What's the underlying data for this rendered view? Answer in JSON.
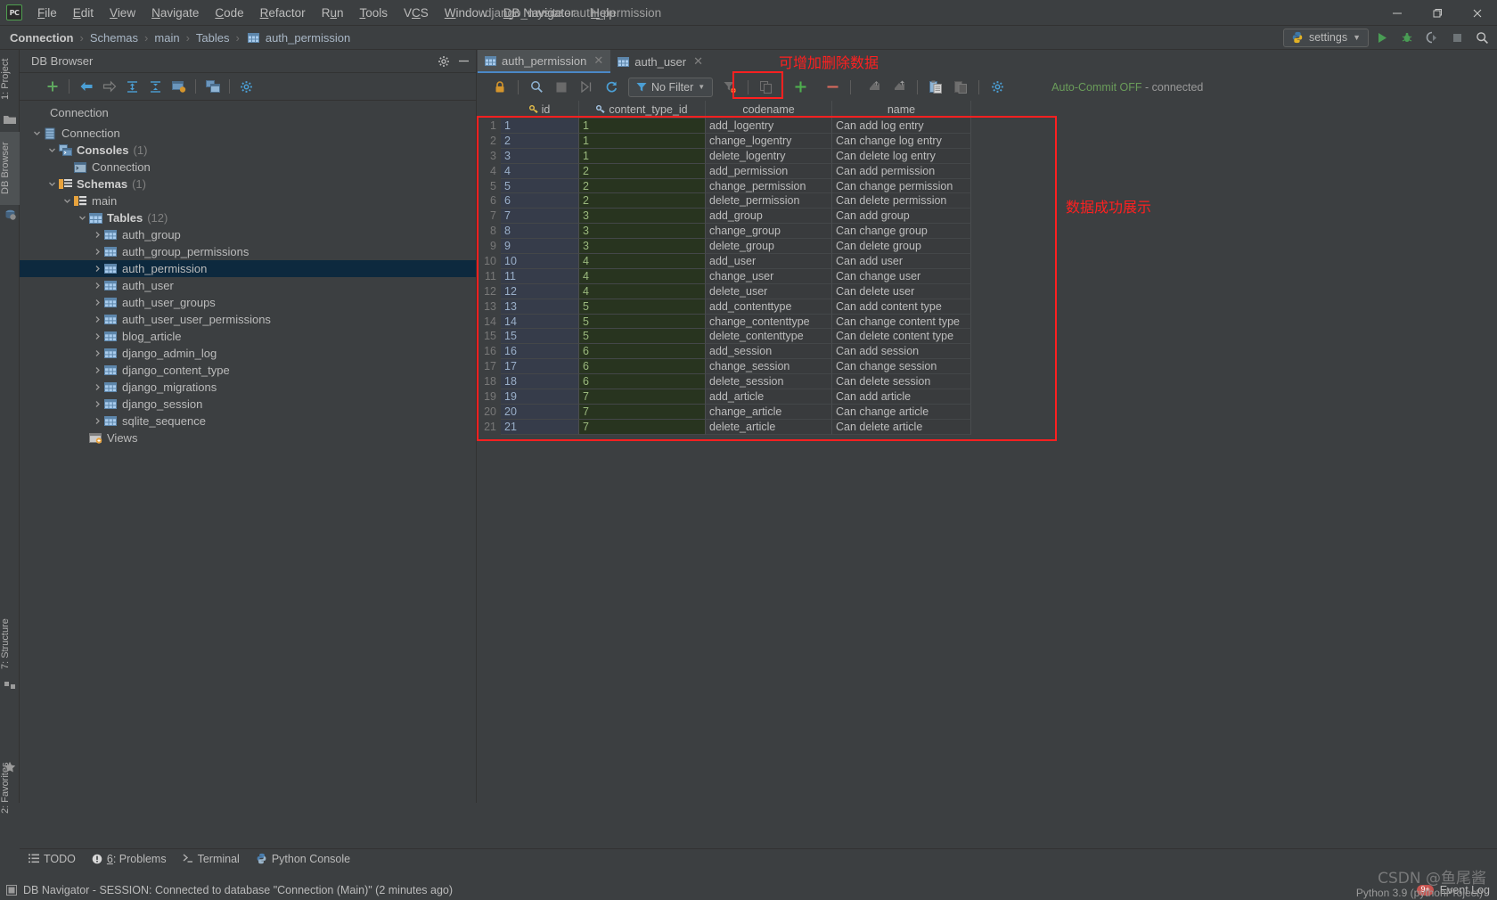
{
  "window": {
    "title": "django_mysite - auth_permission",
    "minimize": "—",
    "maximize": "❐",
    "close": "✕",
    "logo_text": "PC"
  },
  "menu": [
    {
      "label": "File"
    },
    {
      "label": "Edit"
    },
    {
      "label": "View"
    },
    {
      "label": "Navigate"
    },
    {
      "label": "Code"
    },
    {
      "label": "Refactor"
    },
    {
      "label": "Run"
    },
    {
      "label": "Tools"
    },
    {
      "label": "VCS"
    },
    {
      "label": "Window"
    },
    {
      "label": "DB Navigator"
    },
    {
      "label": "Help"
    }
  ],
  "breadcrumb": {
    "items": [
      "Connection",
      "Schemas",
      "main",
      "Tables",
      "auth_permission"
    ],
    "separator": "›"
  },
  "run_config": {
    "label": "settings",
    "caret": "▼"
  },
  "nav_icons": [
    "run-icon",
    "debug-icon",
    "coverage-icon",
    "stop-icon",
    "search-everywhere-icon"
  ],
  "rail": {
    "left_tabs": [
      {
        "label": "1: Project",
        "icon": "project-icon",
        "active": false
      },
      {
        "label": "DB Browser",
        "icon": "db-browser-icon",
        "active": true
      }
    ],
    "bottom_tabs": [
      {
        "label": "7: Structure",
        "icon": "structure-icon"
      },
      {
        "label": "2: Favorites",
        "icon": "favorites-star-icon"
      }
    ]
  },
  "db_panel": {
    "title": "DB Browser",
    "header_icons": [
      "gear-icon",
      "minimize-icon"
    ],
    "toolbar_icons": [
      "add-icon",
      "back-icon",
      "forward-icon",
      "expand-all-icon",
      "collapse-all-icon",
      "console-icon",
      "new-window-icon",
      "settings-icon"
    ],
    "section_label": "Connection",
    "tree": [
      {
        "label": "Connection",
        "icon": "database-icon",
        "depth": 0,
        "arrow": "down",
        "count": "",
        "bold": false,
        "selected": false
      },
      {
        "label": "Consoles",
        "icon": "consoles-icon",
        "depth": 1,
        "arrow": "down",
        "count": "(1)",
        "bold": true,
        "selected": false
      },
      {
        "label": "Connection",
        "icon": "console-item-icon",
        "depth": 2,
        "arrow": "none",
        "count": "",
        "bold": false,
        "selected": false
      },
      {
        "label": "Schemas",
        "icon": "schemas-icon",
        "depth": 1,
        "arrow": "down",
        "count": "(1)",
        "bold": true,
        "selected": false
      },
      {
        "label": "main",
        "icon": "schema-icon",
        "depth": 2,
        "arrow": "down",
        "count": "",
        "bold": false,
        "selected": false
      },
      {
        "label": "Tables",
        "icon": "tables-icon",
        "depth": 3,
        "arrow": "down",
        "count": "(12)",
        "bold": true,
        "selected": false
      },
      {
        "label": "auth_group",
        "icon": "table-icon",
        "depth": 4,
        "arrow": "right",
        "count": "",
        "bold": false,
        "selected": false
      },
      {
        "label": "auth_group_permissions",
        "icon": "table-icon",
        "depth": 4,
        "arrow": "right",
        "count": "",
        "bold": false,
        "selected": false
      },
      {
        "label": "auth_permission",
        "icon": "table-icon",
        "depth": 4,
        "arrow": "right",
        "count": "",
        "bold": false,
        "selected": true
      },
      {
        "label": "auth_user",
        "icon": "table-icon",
        "depth": 4,
        "arrow": "right",
        "count": "",
        "bold": false,
        "selected": false
      },
      {
        "label": "auth_user_groups",
        "icon": "table-icon",
        "depth": 4,
        "arrow": "right",
        "count": "",
        "bold": false,
        "selected": false
      },
      {
        "label": "auth_user_user_permissions",
        "icon": "table-icon",
        "depth": 4,
        "arrow": "right",
        "count": "",
        "bold": false,
        "selected": false
      },
      {
        "label": "blog_article",
        "icon": "table-icon",
        "depth": 4,
        "arrow": "right",
        "count": "",
        "bold": false,
        "selected": false
      },
      {
        "label": "django_admin_log",
        "icon": "table-icon",
        "depth": 4,
        "arrow": "right",
        "count": "",
        "bold": false,
        "selected": false
      },
      {
        "label": "django_content_type",
        "icon": "table-icon",
        "depth": 4,
        "arrow": "right",
        "count": "",
        "bold": false,
        "selected": false
      },
      {
        "label": "django_migrations",
        "icon": "table-icon",
        "depth": 4,
        "arrow": "right",
        "count": "",
        "bold": false,
        "selected": false
      },
      {
        "label": "django_session",
        "icon": "table-icon",
        "depth": 4,
        "arrow": "right",
        "count": "",
        "bold": false,
        "selected": false
      },
      {
        "label": "sqlite_sequence",
        "icon": "table-icon",
        "depth": 4,
        "arrow": "right",
        "count": "",
        "bold": false,
        "selected": false
      },
      {
        "label": "Views",
        "icon": "views-icon",
        "depth": 3,
        "arrow": "none",
        "count": "",
        "bold": false,
        "selected": false
      }
    ]
  },
  "editor": {
    "tabs": [
      {
        "label": "auth_permission",
        "active": true,
        "close": "✕"
      },
      {
        "label": "auth_user",
        "active": false,
        "close": "✕"
      }
    ],
    "toolbar": {
      "filter_label": "No Filter",
      "filter_caret": "▼",
      "icons": [
        "lock-icon",
        "find-icon",
        "stop-icon",
        "execute-icon",
        "refresh-icon",
        "clear-filter-icon",
        "duplicate-record-icon",
        "insert-record-icon",
        "delete-record-icon",
        "import-icon",
        "export-icon",
        "paste-icon",
        "copy-icon",
        "settings-icon"
      ],
      "insert_label": "+",
      "delete_label": "−",
      "autocommit": "Auto-Commit OFF",
      "connection_state": "- connected"
    }
  },
  "grid": {
    "columns": [
      {
        "key": "id",
        "label": "id",
        "primary": true
      },
      {
        "key": "content_type_id",
        "label": "content_type_id",
        "primary": true
      },
      {
        "key": "codename",
        "label": "codename",
        "primary": false
      },
      {
        "key": "name",
        "label": "name",
        "primary": false
      }
    ],
    "rows": [
      {
        "n": "1",
        "id": "1",
        "content_type_id": "1",
        "codename": "add_logentry",
        "name": "Can add log entry"
      },
      {
        "n": "2",
        "id": "2",
        "content_type_id": "1",
        "codename": "change_logentry",
        "name": "Can change log entry"
      },
      {
        "n": "3",
        "id": "3",
        "content_type_id": "1",
        "codename": "delete_logentry",
        "name": "Can delete log entry"
      },
      {
        "n": "4",
        "id": "4",
        "content_type_id": "2",
        "codename": "add_permission",
        "name": "Can add permission"
      },
      {
        "n": "5",
        "id": "5",
        "content_type_id": "2",
        "codename": "change_permission",
        "name": "Can change permission"
      },
      {
        "n": "6",
        "id": "6",
        "content_type_id": "2",
        "codename": "delete_permission",
        "name": "Can delete permission"
      },
      {
        "n": "7",
        "id": "7",
        "content_type_id": "3",
        "codename": "add_group",
        "name": "Can add group"
      },
      {
        "n": "8",
        "id": "8",
        "content_type_id": "3",
        "codename": "change_group",
        "name": "Can change group"
      },
      {
        "n": "9",
        "id": "9",
        "content_type_id": "3",
        "codename": "delete_group",
        "name": "Can delete group"
      },
      {
        "n": "10",
        "id": "10",
        "content_type_id": "4",
        "codename": "add_user",
        "name": "Can add user"
      },
      {
        "n": "11",
        "id": "11",
        "content_type_id": "4",
        "codename": "change_user",
        "name": "Can change user"
      },
      {
        "n": "12",
        "id": "12",
        "content_type_id": "4",
        "codename": "delete_user",
        "name": "Can delete user"
      },
      {
        "n": "13",
        "id": "13",
        "content_type_id": "5",
        "codename": "add_contenttype",
        "name": "Can add content type"
      },
      {
        "n": "14",
        "id": "14",
        "content_type_id": "5",
        "codename": "change_contenttype",
        "name": "Can change content type"
      },
      {
        "n": "15",
        "id": "15",
        "content_type_id": "5",
        "codename": "delete_contenttype",
        "name": "Can delete content type"
      },
      {
        "n": "16",
        "id": "16",
        "content_type_id": "6",
        "codename": "add_session",
        "name": "Can add session"
      },
      {
        "n": "17",
        "id": "17",
        "content_type_id": "6",
        "codename": "change_session",
        "name": "Can change session"
      },
      {
        "n": "18",
        "id": "18",
        "content_type_id": "6",
        "codename": "delete_session",
        "name": "Can delete session"
      },
      {
        "n": "19",
        "id": "19",
        "content_type_id": "7",
        "codename": "add_article",
        "name": "Can add article"
      },
      {
        "n": "20",
        "id": "20",
        "content_type_id": "7",
        "codename": "change_article",
        "name": "Can change article"
      },
      {
        "n": "21",
        "id": "21",
        "content_type_id": "7",
        "codename": "delete_article",
        "name": "Can delete article"
      }
    ]
  },
  "annotations": [
    {
      "id": "toolbar_note",
      "text": "可增加删除数据",
      "color": "#ff2020"
    },
    {
      "id": "grid_note",
      "text": "数据成功展示",
      "color": "#ff2020"
    }
  ],
  "bottom_bar": {
    "items": [
      {
        "label": "TODO",
        "icon": "todo-icon"
      },
      {
        "label": "6: Problems",
        "icon": "problems-icon"
      },
      {
        "label": "Terminal",
        "icon": "terminal-icon"
      },
      {
        "label": "Python Console",
        "icon": "python-console-icon"
      }
    ]
  },
  "status_bar": {
    "message": "DB Navigator - SESSION: Connected to database \"Connection (Main)\" (2 minutes ago)",
    "event_log": "Event Log",
    "event_badge": "9+",
    "python_version": "Python 3.9 (pythonProject)",
    "watermark": "CSDN @鱼尾酱"
  },
  "colors": {
    "accent_blue": "#4a88c7",
    "selection": "#0d293e",
    "annotation_red": "#ff2020",
    "green_ok": "#6a9c5a",
    "id_cell_bg": "#363c4a",
    "ct_cell_bg": "#28341f"
  }
}
